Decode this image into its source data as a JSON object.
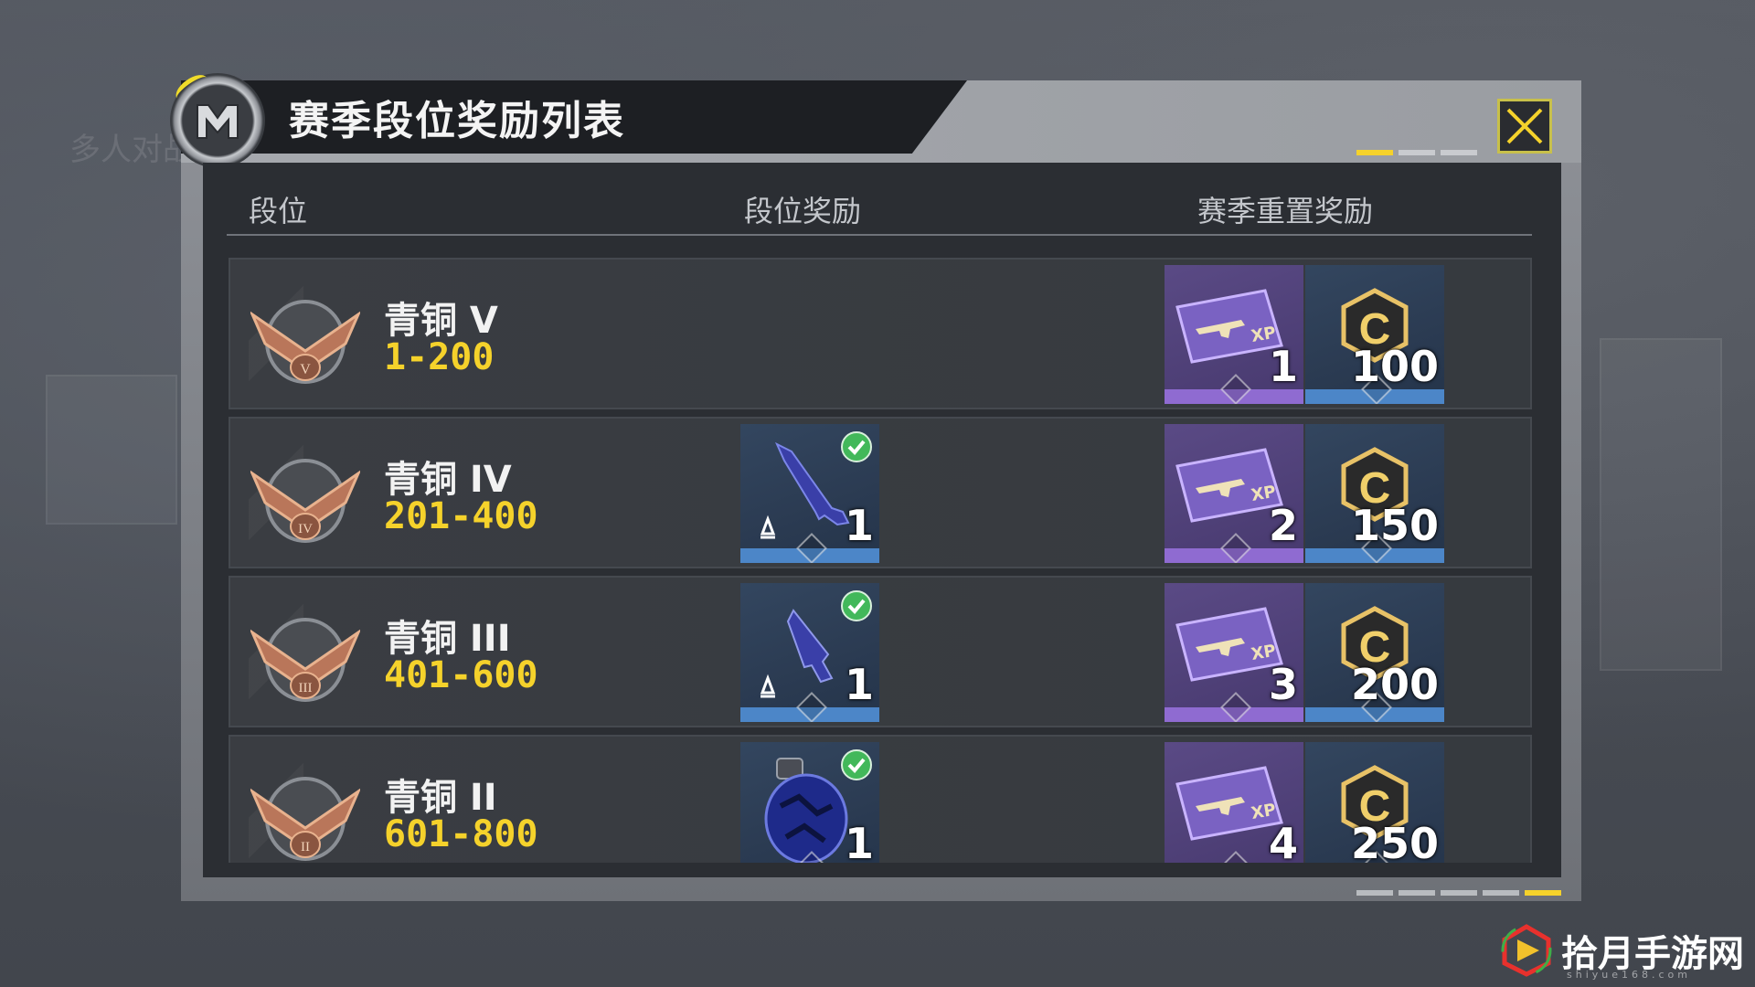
{
  "background": {
    "faint_label": "多人对战"
  },
  "dialog": {
    "title": "赛季段位奖励列表",
    "columns": [
      "段位",
      "段位奖励",
      "赛季重置奖励"
    ]
  },
  "rows": [
    {
      "rank": "青铜 V",
      "range": "1-200",
      "rank_reward": null,
      "reset_rewards": [
        {
          "type": "xp-card",
          "count": "1"
        },
        {
          "type": "cp-coin",
          "count": "100"
        }
      ]
    },
    {
      "rank": "青铜 IV",
      "range": "201-400",
      "rank_reward": {
        "type": "rifle-blueprint",
        "count": "1",
        "claimed": true
      },
      "reset_rewards": [
        {
          "type": "xp-card",
          "count": "2"
        },
        {
          "type": "cp-coin",
          "count": "150"
        }
      ]
    },
    {
      "rank": "青铜 III",
      "range": "401-600",
      "rank_reward": {
        "type": "pistol-blueprint",
        "count": "1",
        "claimed": true
      },
      "reset_rewards": [
        {
          "type": "xp-card",
          "count": "3"
        },
        {
          "type": "cp-coin",
          "count": "200"
        }
      ]
    },
    {
      "rank": "青铜 II",
      "range": "601-800",
      "rank_reward": {
        "type": "grenade-skin",
        "count": "1",
        "claimed": true
      },
      "reset_rewards": [
        {
          "type": "xp-card",
          "count": "4"
        },
        {
          "type": "cp-coin",
          "count": "250"
        }
      ]
    }
  ],
  "watermark": {
    "text": "拾月手游网",
    "sub": "shiyue168.com"
  },
  "colors": {
    "accent_yellow": "#f5d22b",
    "claimed_green": "#42b85a",
    "xp_purple": "#8f6bd1",
    "cp_blue": "#4c86c8"
  }
}
